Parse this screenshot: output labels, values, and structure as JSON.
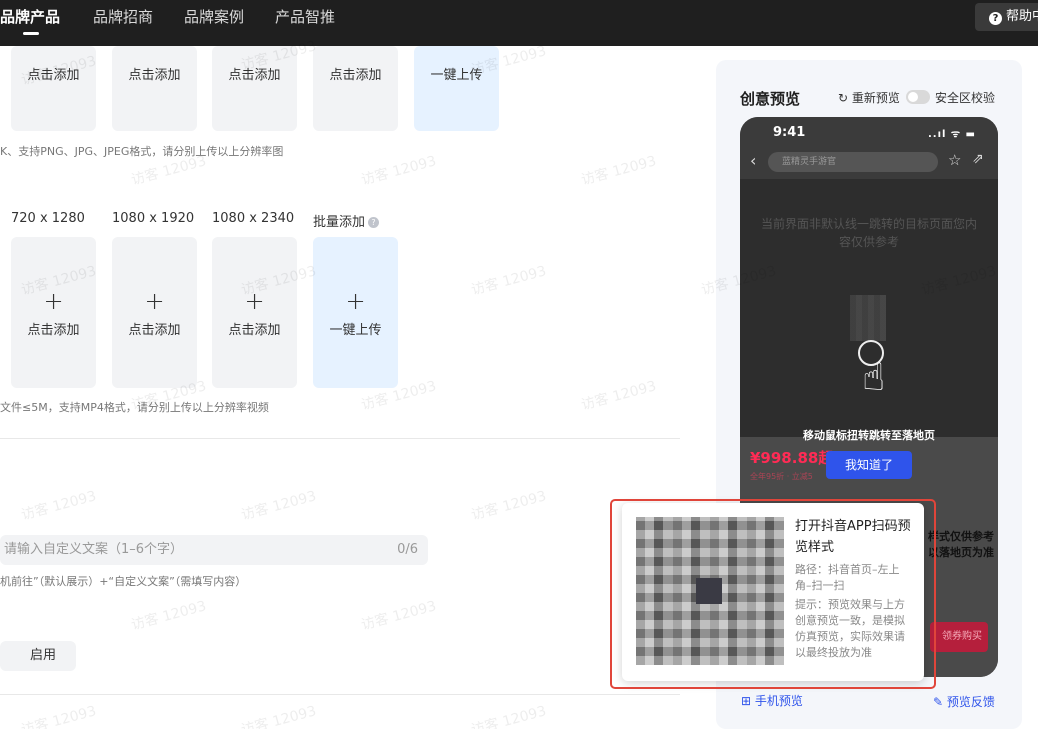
{
  "nav": {
    "items": [
      "品牌产品",
      "品牌招商",
      "品牌案例",
      "产品智推"
    ],
    "active_index": 0,
    "help_label": "帮助中心"
  },
  "image_upload": {
    "tiles": [
      {
        "label": "点击添加"
      },
      {
        "label": "点击添加"
      },
      {
        "label": "点击添加"
      },
      {
        "label": "点击添加"
      },
      {
        "label": "一键上传"
      }
    ],
    "hint": "K、支持PNG、JPG、JPEG格式，请分别上传以上分辨率图"
  },
  "video_upload": {
    "columns": [
      {
        "resolution": "720 x 1280",
        "label": "点击添加"
      },
      {
        "resolution": "1080 x 1920",
        "label": "点击添加"
      },
      {
        "resolution": "1080 x 2340",
        "label": "点击添加"
      },
      {
        "resolution": "批量添加",
        "label": "一键上传"
      }
    ],
    "hint": "文件≤5M，支持MP4格式，请分别上传以上分辨率视频"
  },
  "custom_text": {
    "placeholder": "请输入自定义文案（1–6个字）",
    "counter": "0/6",
    "hint": "机前往”（默认展示）+“自定义文案”（需填写内容）"
  },
  "enable_button": "启用",
  "preview": {
    "title": "创意预览",
    "refresh_label": "重新预览",
    "safe_area_label": "安全区校验",
    "safe_area_enabled": false,
    "phone": {
      "time": "9:41",
      "signal": "..ıl ᯤ ▬",
      "search_text": "蓝精灵手游官",
      "video_text": "当前界面非默认线一跳转的目标页面您内容仅供参考",
      "tip": "移动鼠标扭转跳转至落地页",
      "price": "¥998.88起",
      "price_sub": "全年95折 · 立减5",
      "got_it": "我知道了",
      "side_text": "样式仅供参考以落地页为准",
      "buy_label": "领券购买"
    },
    "mobile_preview_label": "手机预览",
    "feedback_label": "预览反馈"
  },
  "qr_popup": {
    "title": "打开抖音APP扫码预览样式",
    "path": "路径：抖音首页–左上角–扫一扫",
    "tip": "提示：预览效果与上方创意预览一致，是模拟仿真预览，实际效果请以最终投放为准"
  },
  "watermark_text": "访客 12093",
  "colors": {
    "nav_bg": "#1f1f1f",
    "accent": "#2f54eb",
    "highlight_frame": "#e0453a",
    "price": "#ff2b55"
  },
  "icons": {
    "refresh": "refresh-icon",
    "help": "question-circle-icon",
    "info": "info-icon",
    "qr_scan": "qr-scan-icon",
    "feedback": "edit-icon",
    "hand": "hand-pointer-icon"
  }
}
